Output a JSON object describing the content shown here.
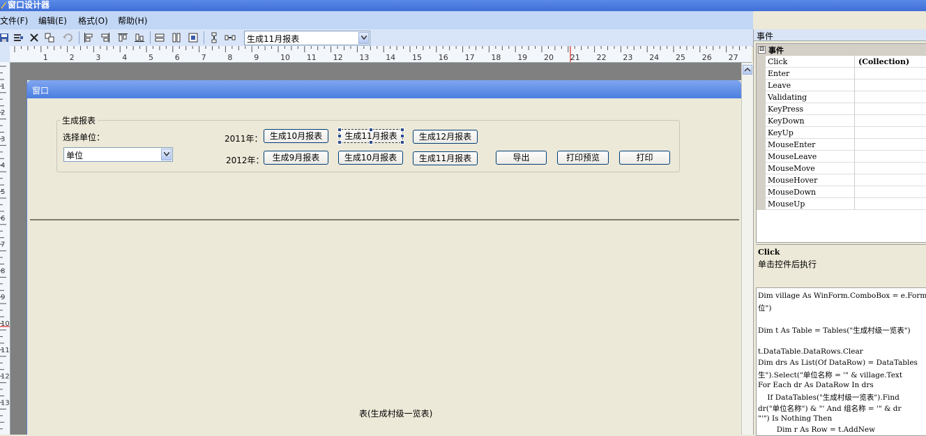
{
  "app": {
    "title": "窗口设计器"
  },
  "menu": [
    "文件(F)",
    "编辑(E)",
    "格式(O)",
    "帮助(H)"
  ],
  "toolbar": {
    "icons": [
      "save-icon",
      "text-format-icon",
      "delete-icon",
      "copy-icon",
      "undo-icon",
      "align-left-icon",
      "align-right-icon",
      "align-top-icon",
      "align-bottom-icon",
      "same-width-icon",
      "same-height-icon",
      "same-size-icon",
      "vertical-spacing-icon",
      "horizontal-spacing-icon"
    ],
    "selected_control": "生成11月报表"
  },
  "ruler": {
    "h_labels": [
      "1",
      "2",
      "3",
      "4",
      "5",
      "6",
      "7",
      "8",
      "9",
      "10",
      "11",
      "12",
      "13",
      "14",
      "15",
      "16",
      "17",
      "18",
      "19",
      "20",
      "21",
      "22",
      "23",
      "24",
      "25",
      "26",
      "27"
    ],
    "v_labels": [
      "1",
      "2",
      "3",
      "4",
      "5",
      "6",
      "7",
      "8",
      "9",
      "10",
      "11",
      "12",
      "13"
    ]
  },
  "form": {
    "title": "窗口",
    "group_title": "生成报表",
    "unit_label": "选择单位：",
    "unit_value": "单位",
    "row1_label": "2011年：",
    "row2_label": "2012年：",
    "buttons_row1": [
      "生成10月报表",
      "生成11月报表",
      "生成12月报表"
    ],
    "buttons_row2": [
      "生成9月报表",
      "生成10月报表",
      "生成11月报表"
    ],
    "export_label": "导出",
    "preview_label": "打印预览",
    "print_label": "打印",
    "grid_caption": "表(生成村级一览表)"
  },
  "panel": {
    "title": "事件",
    "category": "事件",
    "category_toggle": "⊟",
    "events": [
      {
        "name": "Click",
        "value": "(Collection)"
      },
      {
        "name": "Enter",
        "value": ""
      },
      {
        "name": "Leave",
        "value": ""
      },
      {
        "name": "Validating",
        "value": ""
      },
      {
        "name": "KeyPress",
        "value": ""
      },
      {
        "name": "KeyDown",
        "value": ""
      },
      {
        "name": "KeyUp",
        "value": ""
      },
      {
        "name": "MouseEnter",
        "value": ""
      },
      {
        "name": "MouseLeave",
        "value": ""
      },
      {
        "name": "MouseMove",
        "value": ""
      },
      {
        "name": "MouseHover",
        "value": ""
      },
      {
        "name": "MouseDown",
        "value": ""
      },
      {
        "name": "MouseUp",
        "value": ""
      }
    ],
    "desc_title": "Click",
    "desc_text": "单击控件后执行",
    "code_lines": [
      "Dim village As WinForm.ComboBox = e.Form.",
      "位\")",
      "",
      "Dim t As Table = Tables(\"生成村级一览表\")",
      "",
      "t.DataTable.DataRows.Clear",
      "Dim drs As List(Of DataRow) = DataTables",
      "生\").Select(\"单位名称 = '\" & village.Text",
      "For Each dr As DataRow In drs",
      "    If DataTables(\"生成村级一览表\").Find",
      "dr(\"单位名称\") & \"' And 组名称 = '\" & dr",
      "\"'\") Is Nothing Then",
      "        Dim r As Row = t.AddNew"
    ]
  }
}
